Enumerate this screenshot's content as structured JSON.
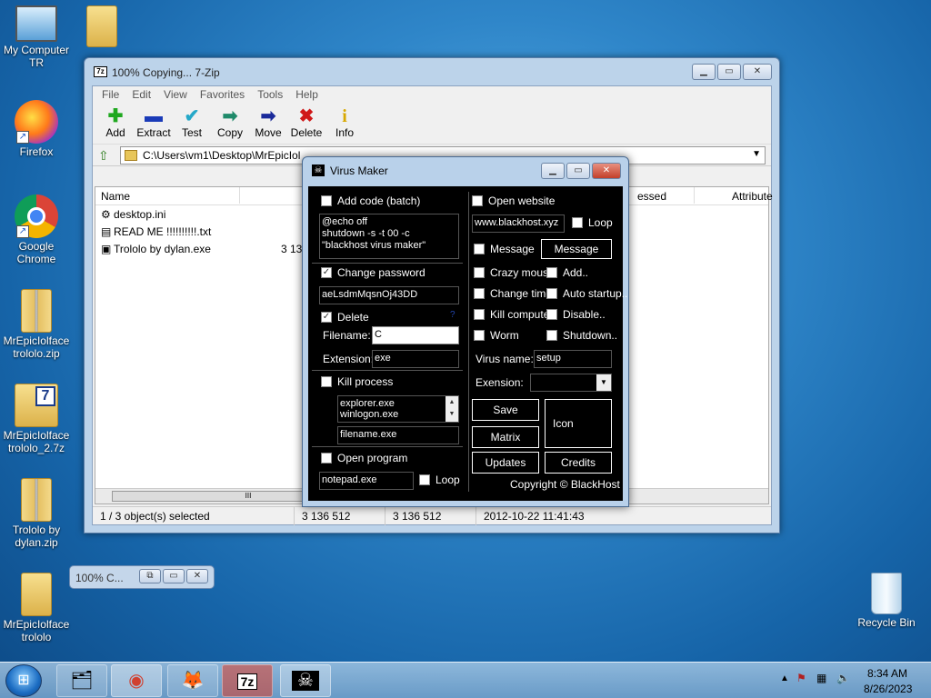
{
  "desktop": {
    "icons": [
      {
        "label": "My Computer TR",
        "kind": "computer"
      },
      {
        "label": "Firefox",
        "kind": "firefox"
      },
      {
        "label": "Google Chrome",
        "kind": "chrome"
      },
      {
        "label": "MrEpicIolface trololo.zip",
        "kind": "zip"
      },
      {
        "label": "MrEpicIolface trololo_2.7z",
        "kind": "7z"
      },
      {
        "label": "Trololo by dylan.zip",
        "kind": "zip"
      },
      {
        "label": "MrEpicIolface trololo",
        "kind": "folder"
      },
      {
        "label": "Recycle Bin",
        "kind": "recycle"
      }
    ]
  },
  "sevenzip": {
    "title": "100% Copying... 7-Zip",
    "app_icon": "7z",
    "menu": [
      "File",
      "Edit",
      "View",
      "Favorites",
      "Tools",
      "Help"
    ],
    "toolbar": [
      {
        "label": "Add",
        "icon": "plus-icon",
        "glyph": "✚",
        "color": "#1fa81f"
      },
      {
        "label": "Extract",
        "icon": "minus-icon",
        "glyph": "▬",
        "color": "#1a3bb8"
      },
      {
        "label": "Test",
        "icon": "check-icon",
        "glyph": "✔",
        "color": "#25a8c8"
      },
      {
        "label": "Copy",
        "icon": "copy-arrow-icon",
        "glyph": "➡",
        "color": "#1f8a6a"
      },
      {
        "label": "Move",
        "icon": "move-arrow-icon",
        "glyph": "➡",
        "color": "#1a2a9a"
      },
      {
        "label": "Delete",
        "icon": "delete-x-icon",
        "glyph": "✖",
        "color": "#d01818"
      },
      {
        "label": "Info",
        "icon": "info-icon",
        "glyph": "i",
        "color": "#d8a800"
      }
    ],
    "path": "C:\\Users\\vm1\\Desktop\\MrEpicIol",
    "columns": {
      "name": "Name",
      "size": "",
      "packed": "essed",
      "attributes": "Attribute"
    },
    "files": [
      {
        "name": "desktop.ini",
        "size": ""
      },
      {
        "name": "READ ME !!!!!!!!!!.txt",
        "size": ""
      },
      {
        "name": "Trololo by dylan.exe",
        "size": "3 136"
      }
    ],
    "scroll_thumb": "III",
    "status": {
      "selected": "1 / 3 object(s) selected",
      "size": "3 136 512",
      "packed": "3 136 512",
      "modified": "2012-10-22 11:41:43"
    }
  },
  "virus_maker": {
    "title": "Virus Maker",
    "left": {
      "add_code_label": "Add code (batch)",
      "add_code_checked": false,
      "batch_code": "@echo off\nshutdown -s -t 00 -c \"blackhost virus maker\"",
      "change_password_label": "Change password",
      "change_password_checked": true,
      "password": "aeLsdmMqsnOj43DD",
      "delete_label": "Delete",
      "delete_checked": true,
      "delete_help": "?",
      "filename_label": "Filename:",
      "filename_value": "C",
      "extension_label": "Extension:",
      "extension_value": "exe",
      "kill_label": "Kill process",
      "kill_checked": false,
      "processes": [
        "explorer.exe",
        "winlogon.exe"
      ],
      "kill_filename": "filename.exe",
      "open_program_label": "Open program",
      "open_program_checked": false,
      "program": "notepad.exe",
      "loop_label": "Loop",
      "loop_checked": false
    },
    "right": {
      "open_website_label": "Open website",
      "open_website_checked": false,
      "website": "www.blackhost.xyz",
      "loop_label": "Loop",
      "loop_checked": false,
      "message_label": "Message",
      "message_button": "Message",
      "options": [
        {
          "label": "Crazy mouse"
        },
        {
          "label": "Add.."
        },
        {
          "label": "Change time"
        },
        {
          "label": "Auto startup.."
        },
        {
          "label": "Kill computer"
        },
        {
          "label": "Disable.."
        },
        {
          "label": "Worm"
        },
        {
          "label": "Shutdown.."
        }
      ],
      "virus_name_label": "Virus name:",
      "virus_name": "setup",
      "extension_label": "Exension:",
      "extension_value": "",
      "save": "Save",
      "matrix": "Matrix",
      "icon": "Icon",
      "updates": "Updates",
      "credits": "Credits",
      "copyright": "Copyright © BlackHost"
    }
  },
  "mini_window": {
    "title": "100% C..."
  },
  "taskbar": {
    "time": "8:34 AM",
    "date": "8/26/2023",
    "apps": [
      {
        "name": "explorer",
        "glyph": "🗂"
      },
      {
        "name": "chrome",
        "glyph": "◉"
      },
      {
        "name": "firefox",
        "glyph": "🦊"
      },
      {
        "name": "7zip",
        "glyph": "7z"
      },
      {
        "name": "virus-maker",
        "glyph": "☠"
      }
    ]
  }
}
